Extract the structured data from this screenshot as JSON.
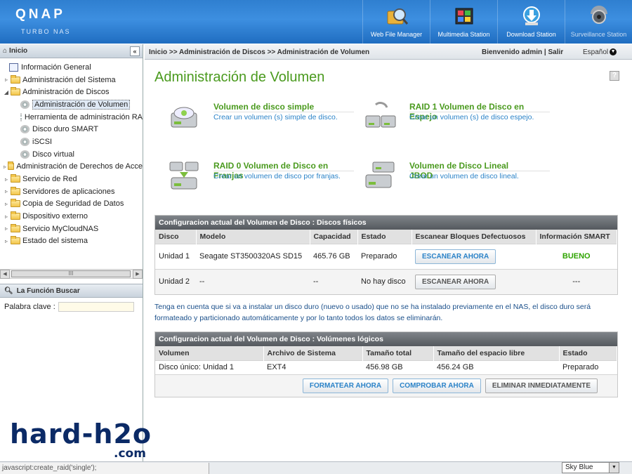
{
  "header": {
    "logo": "QNAP",
    "logo_sub": "TURBO NAS",
    "apps": [
      {
        "label": "Web File Manager",
        "icon": "web-file-manager-icon"
      },
      {
        "label": "Multimedia Station",
        "icon": "multimedia-station-icon"
      },
      {
        "label": "Download Station",
        "icon": "download-station-icon"
      },
      {
        "label": "Surveillance Station",
        "icon": "surveillance-station-icon"
      }
    ]
  },
  "sidebar": {
    "title": "Inicio",
    "collapse": "«",
    "tree": [
      {
        "label": "Información General",
        "level": 0,
        "icon": "page"
      },
      {
        "label": "Administración del Sistema",
        "level": 0,
        "icon": "folder",
        "expander": "▹"
      },
      {
        "label": "Administración de Discos",
        "level": 0,
        "icon": "folder",
        "expander": "◢"
      },
      {
        "label": "Administración de Volumen",
        "level": 1,
        "icon": "disk",
        "selected": true
      },
      {
        "label": "Herramienta de administración RA",
        "level": 1,
        "icon": "disk"
      },
      {
        "label": "Disco duro SMART",
        "level": 1,
        "icon": "disk"
      },
      {
        "label": "iSCSI",
        "level": 1,
        "icon": "disk"
      },
      {
        "label": "Disco virtual",
        "level": 1,
        "icon": "disk"
      },
      {
        "label": "Administración de Derechos de Acce",
        "level": 0,
        "icon": "folder",
        "expander": "▹"
      },
      {
        "label": "Servicio de Red",
        "level": 0,
        "icon": "folder",
        "expander": "▹"
      },
      {
        "label": "Servidores de aplicaciones",
        "level": 0,
        "icon": "folder",
        "expander": "▹"
      },
      {
        "label": "Copia de Seguridad de Datos",
        "level": 0,
        "icon": "folder",
        "expander": "▹"
      },
      {
        "label": "Dispositivo externo",
        "level": 0,
        "icon": "folder",
        "expander": "▹"
      },
      {
        "label": "Servicio MyCloudNAS",
        "level": 0,
        "icon": "folder",
        "expander": "▹"
      },
      {
        "label": "Estado del sistema",
        "level": 0,
        "icon": "folder",
        "expander": "▹"
      }
    ],
    "scroll_grip": "III",
    "search_title": "La Función Buscar",
    "search_label": "Palabra clave :",
    "search_value": ""
  },
  "topbar": {
    "breadcrumb": "Inicio >> Administración de Discos >> Administración de Volumen",
    "welcome": "Bienvenido admin | Salir",
    "language": "Español"
  },
  "main": {
    "title": "Administración de Volumen",
    "help": "?",
    "options": [
      {
        "title": "Volumen de disco simple",
        "desc": "Crear un volumen (s) simple de disco."
      },
      {
        "title": "RAID 1 Volumen de Disco en Espejo",
        "desc": "Crear un volumen (s) de disco espejo."
      },
      {
        "title": "RAID 0 Volumen de Disco en Franjas",
        "desc": "Crear un volumen de disco por franjas."
      },
      {
        "title": "Volumen de Disco Lineal JBOD",
        "desc": "Crear un volumen de disco lineal."
      }
    ],
    "physical": {
      "caption": "Configuracion actual del Volumen de Disco : Discos físicos",
      "headers": [
        "Disco",
        "Modelo",
        "Capacidad",
        "Estado",
        "Escanear Bloques Defectuosos",
        "Información SMART"
      ],
      "rows": [
        {
          "disk": "Unidad 1",
          "model": "Seagate ST3500320AS SD15",
          "capacity": "465.76 GB",
          "state": "Preparado",
          "scan": "ESCANEAR AHORA",
          "smart": "BUENO"
        },
        {
          "disk": "Unidad 2",
          "model": "--",
          "capacity": "--",
          "state": "No hay disco",
          "scan": "ESCANEAR AHORA",
          "smart": "---"
        }
      ]
    },
    "note": "Tenga en cuenta que si va a instalar un disco duro (nuevo o usado) que no se ha instalado previamente en el NAS, el disco duro será formateado y particionado automáticamente y por lo tanto todos los datos se eliminarán.",
    "logical": {
      "caption": "Configuracion actual del Volumen de Disco : Volúmenes lógicos",
      "headers": [
        "Volumen",
        "Archivo de Sistema",
        "Tamaño total",
        "Tamaño del espacio libre",
        "Estado"
      ],
      "rows": [
        {
          "volume": "Disco único: Unidad 1",
          "fs": "EXT4",
          "total": "456.98 GB",
          "free": "456.24 GB",
          "state": "Preparado"
        }
      ],
      "actions": [
        "FORMATEAR AHORA",
        "COMPROBAR AHORA",
        "ELIMINAR INMEDIATAMENTE"
      ]
    }
  },
  "footer": {
    "status": "javascript:create_raid('single');",
    "theme": "Sky Blue"
  },
  "watermark": {
    "main": "hard-h2o",
    "sub": ".com"
  }
}
